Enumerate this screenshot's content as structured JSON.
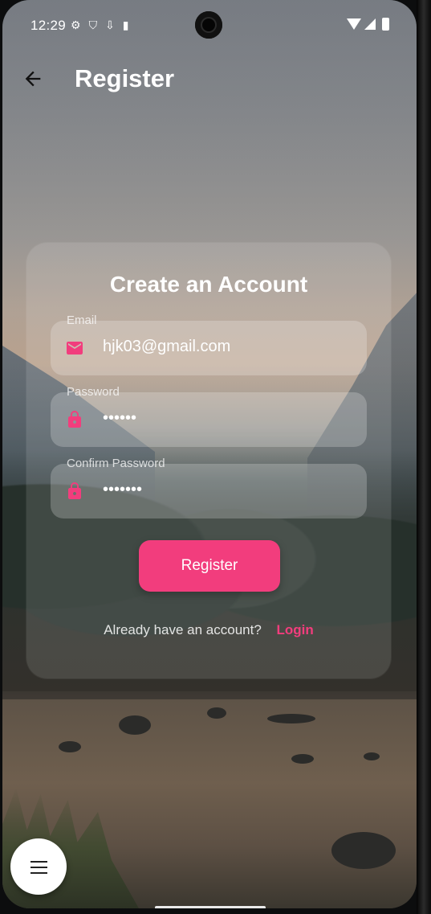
{
  "status_bar": {
    "time": "12:29",
    "left_icons": [
      "settings-icon",
      "shield-icon",
      "download-icon",
      "sd-card-icon"
    ],
    "right_icons": [
      "wifi-icon",
      "signal-icon",
      "battery-icon"
    ]
  },
  "app_bar": {
    "title": "Register",
    "back_icon": "arrow-back-icon"
  },
  "card": {
    "title": "Create an Account",
    "fields": [
      {
        "label": "Email",
        "value": "hjk03@gmail.com",
        "icon": "mail-icon"
      },
      {
        "label": "Password",
        "value": "••••••",
        "icon": "lock-icon"
      },
      {
        "label": "Confirm Password",
        "value": "•••••••",
        "icon": "lock-icon"
      }
    ],
    "register_label": "Register",
    "login_prompt": "Already have an account?",
    "login_link": "Login"
  },
  "fab": {
    "icon": "menu-icon"
  },
  "colors": {
    "accent": "#f23d7d",
    "text": "#ffffff"
  }
}
